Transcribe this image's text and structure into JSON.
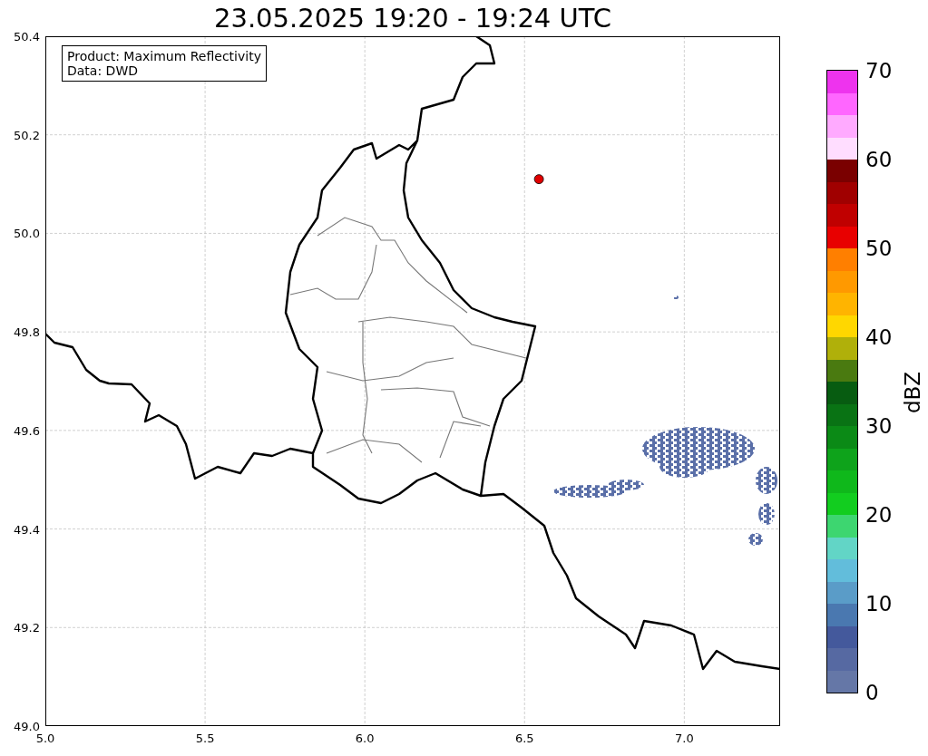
{
  "title": "23.05.2025 19:20 - 19:24 UTC",
  "map": {
    "info_box": [
      "Product: Maximum Reflectivity",
      "Data: DWD"
    ],
    "x_tick_labels": [
      "5.0",
      "5.5",
      "6.0",
      "6.5",
      "7.0"
    ],
    "y_tick_labels": [
      "50.4",
      "50.2",
      "50.0",
      "49.8",
      "49.6",
      "49.4",
      "49.2",
      "49.0"
    ]
  },
  "colorbar": {
    "label": "dBZ",
    "tick_labels": [
      "70",
      "60",
      "50",
      "40",
      "30",
      "20",
      "10",
      "0"
    ],
    "bins": [
      {
        "color": "#6577a7"
      },
      {
        "color": "#5669a2"
      },
      {
        "color": "#44599c"
      },
      {
        "color": "#4a78b0"
      },
      {
        "color": "#5a9cc8"
      },
      {
        "color": "#62bddb"
      },
      {
        "color": "#62d5c6"
      },
      {
        "color": "#3dd670"
      },
      {
        "color": "#12cd1f"
      },
      {
        "color": "#0fb81b"
      },
      {
        "color": "#0ea31b"
      },
      {
        "color": "#0b8a16"
      },
      {
        "color": "#097314"
      },
      {
        "color": "#075c11"
      },
      {
        "color": "#4a7a10"
      },
      {
        "color": "#b0b00a"
      },
      {
        "color": "#ffd700"
      },
      {
        "color": "#ffb400"
      },
      {
        "color": "#ff9900"
      },
      {
        "color": "#ff7f00"
      },
      {
        "color": "#e80000"
      },
      {
        "color": "#c00000"
      },
      {
        "color": "#a00000"
      },
      {
        "color": "#7a0000"
      },
      {
        "color": "#ffddff"
      },
      {
        "color": "#ffaaff"
      },
      {
        "color": "#ff66ff"
      },
      {
        "color": "#ee33ee"
      }
    ]
  }
}
